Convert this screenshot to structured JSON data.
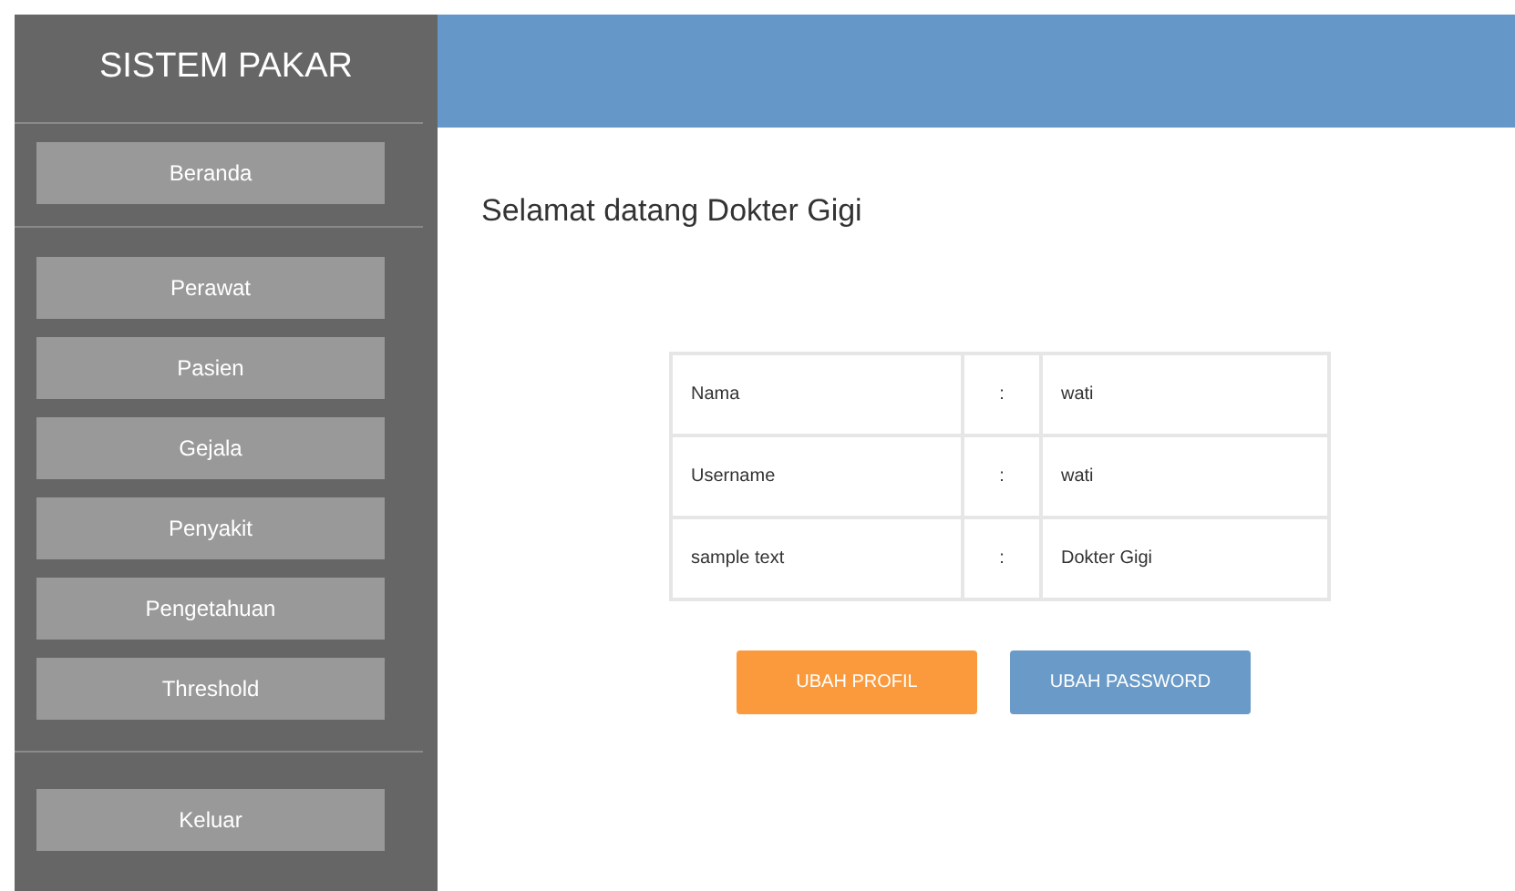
{
  "sidebar": {
    "title": "SISTEM PAKAR",
    "sections": [
      {
        "items": [
          "Beranda"
        ]
      },
      {
        "items": [
          "Perawat",
          "Pasien",
          "Gejala",
          "Penyakit",
          "Pengetahuan",
          "Threshold"
        ]
      },
      {
        "items": [
          "Keluar"
        ]
      }
    ]
  },
  "heading": "Selamat datang Dokter Gigi",
  "profile": [
    {
      "label": "Nama",
      "separator": ":",
      "value": "wati"
    },
    {
      "label": "Username",
      "separator": ":",
      "value": "wati"
    },
    {
      "label": "sample text",
      "separator": ":",
      "value": "Dokter Gigi"
    }
  ],
  "buttons": [
    {
      "label": "UBAH PROFIL",
      "kind": "primary"
    },
    {
      "label": "UBAH PASSWORD",
      "kind": "secondary"
    }
  ]
}
